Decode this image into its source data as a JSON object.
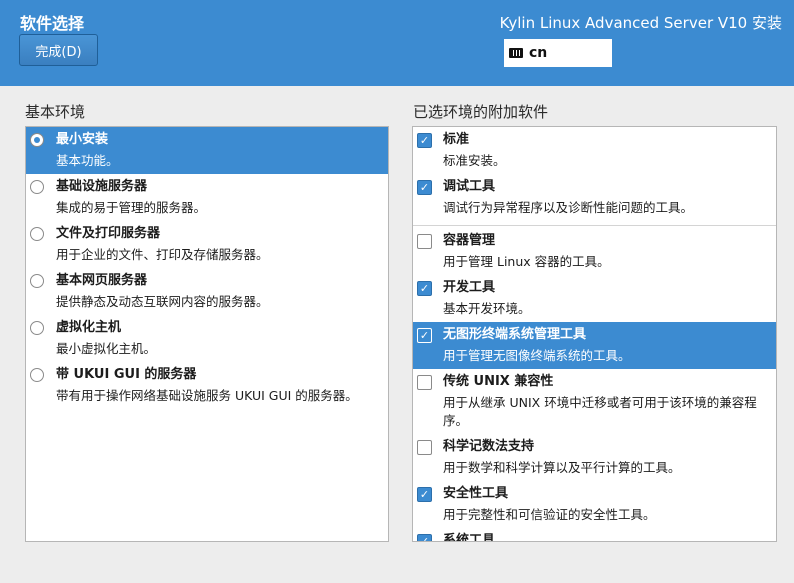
{
  "header": {
    "title": "软件选择",
    "done_label": "完成(D)",
    "product": "Kylin Linux Advanced Server V10 安装",
    "keyboard_layout": "cn"
  },
  "base_env": {
    "heading": "基本环境",
    "items": [
      {
        "name": "最小安装",
        "desc": "基本功能。"
      },
      {
        "name": "基础设施服务器",
        "desc": "集成的易于管理的服务器。"
      },
      {
        "name": "文件及打印服务器",
        "desc": "用于企业的文件、打印及存储服务器。"
      },
      {
        "name": "基本网页服务器",
        "desc": "提供静态及动态互联网内容的服务器。"
      },
      {
        "name": "虚拟化主机",
        "desc": "最小虚拟化主机。"
      },
      {
        "name": "带 UKUI GUI 的服务器",
        "desc": "带有用于操作网络基础设施服务 UKUI GUI 的服务器。"
      }
    ]
  },
  "addons": {
    "heading": "已选环境的附加软件",
    "items": [
      {
        "name": "标准",
        "desc": "标准安装。"
      },
      {
        "name": "调试工具",
        "desc": "调试行为异常程序以及诊断性能问题的工具。"
      },
      {
        "name": "容器管理",
        "desc": "用于管理 Linux 容器的工具。"
      },
      {
        "name": "开发工具",
        "desc": "基本开发环境。"
      },
      {
        "name": "无图形终端系统管理工具",
        "desc": "用于管理无图像终端系统的工具。"
      },
      {
        "name": "传统 UNIX 兼容性",
        "desc": "用于从继承 UNIX 环境中迁移或者可用于该环境的兼容程序。"
      },
      {
        "name": "科学记数法支持",
        "desc": "用于数学和科学计算以及平行计算的工具。"
      },
      {
        "name": "安全性工具",
        "desc": "用于完整性和可信验证的安全性工具。"
      },
      {
        "name": "系统工具",
        "desc": ""
      }
    ]
  }
}
